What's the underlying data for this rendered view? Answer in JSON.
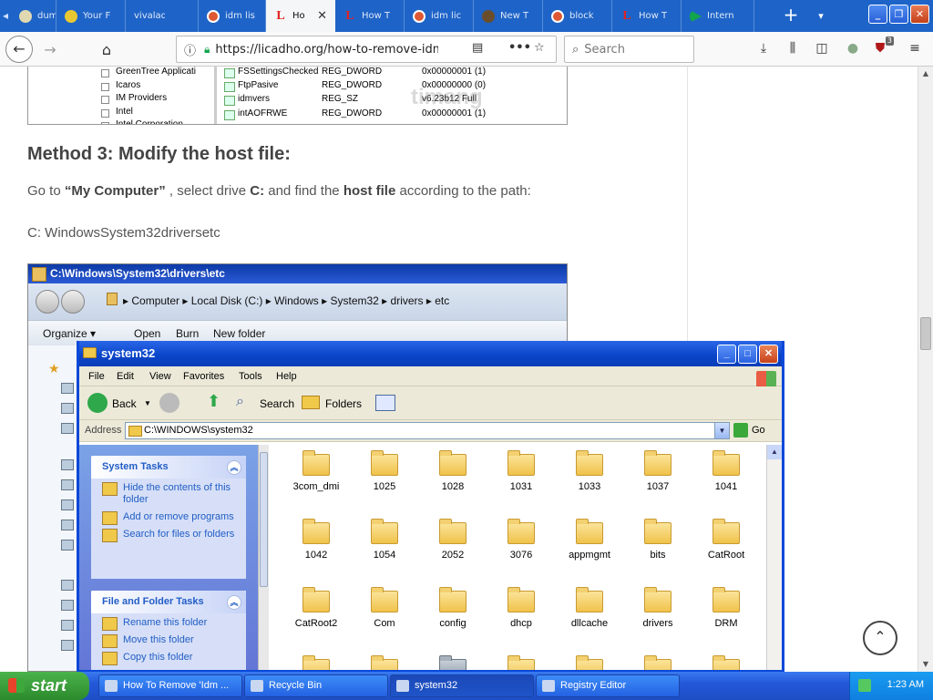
{
  "browser": {
    "tabs": [
      {
        "label": "dum",
        "favicon": "edge"
      },
      {
        "label": "Your F",
        "favicon": "yellow"
      },
      {
        "label": "vivalado",
        "favicon": "none"
      },
      {
        "label": "idm lis",
        "favicon": "duckduckgo"
      },
      {
        "label": "Ho",
        "favicon": "licadho-l",
        "active": true
      },
      {
        "label": "How T",
        "favicon": "licadho-l"
      },
      {
        "label": "idm lic",
        "favicon": "duckduckgo"
      },
      {
        "label": "New T",
        "favicon": "bug"
      },
      {
        "label": "block",
        "favicon": "duckduckgo"
      },
      {
        "label": "How T",
        "favicon": "licadho-l"
      },
      {
        "label": "Intern",
        "favicon": "play"
      }
    ],
    "url": "https://licadho.org/how-to-remove-idm-f",
    "search_placeholder": "Search",
    "addon_badge": "3",
    "colors": {
      "tabbar": "#1e64c8"
    }
  },
  "article": {
    "registry": {
      "tree": [
        "GreenTree Applicati",
        "Icaros",
        "IM Providers",
        "Intel",
        "Intel Corporation"
      ],
      "values": [
        {
          "name": "FSSettingsChecked",
          "type": "REG_DWORD",
          "data": "0x00000001 (1)"
        },
        {
          "name": "FtpPasive",
          "type": "REG_DWORD",
          "data": "0x00000000 (0)"
        },
        {
          "name": "idmvers",
          "type": "REG_SZ",
          "data": "v6.23b12 Full"
        },
        {
          "name": "intAOFRWE",
          "type": "REG_DWORD",
          "data": "0x00000001 (1)"
        }
      ],
      "watermark": "timang"
    },
    "heading": "Method 3: Modify the host file:",
    "para1_pre": "Go to ",
    "para1_b1": "“My Computer”",
    "para1_mid1": " , select drive ",
    "para1_b2": "C:",
    "para1_mid2": " and find the ",
    "para1_b3": "host file",
    "para1_post": " according to the path:",
    "path": "C: WindowsSystem32driversetc",
    "w7shot": {
      "title": "C:\\Windows\\System32\\drivers\\etc",
      "breadcrumb": "▸  Computer  ▸  Local Disk (C:)  ▸  Windows  ▸  System32  ▸  drivers  ▸  etc",
      "toolbar": [
        "Organize ▾",
        "Open",
        "Burn",
        "New folder"
      ]
    }
  },
  "xp_window": {
    "title": "system32",
    "menu": [
      "File",
      "Edit",
      "View",
      "Favorites",
      "Tools",
      "Help"
    ],
    "toolbar": {
      "back": "Back",
      "search": "Search",
      "folders": "Folders"
    },
    "address_label": "Address",
    "address": "C:\\WINDOWS\\system32",
    "go": "Go",
    "system_tasks": {
      "title": "System Tasks",
      "items": [
        "Hide the contents of this folder",
        "Add or remove programs",
        "Search for files or folders"
      ]
    },
    "file_tasks": {
      "title": "File and Folder Tasks",
      "items": [
        "Rename this folder",
        "Move this folder",
        "Copy this folder"
      ]
    },
    "folders": [
      "3com_dmi",
      "1025",
      "1028",
      "1031",
      "1033",
      "1037",
      "1041",
      "1042",
      "1054",
      "2052",
      "3076",
      "appmgmt",
      "bits",
      "CatRoot",
      "CatRoot2",
      "Com",
      "config",
      "dhcp",
      "dllcache",
      "drivers",
      "DRM"
    ]
  },
  "taskbar": {
    "start": "start",
    "tasks": [
      "How To Remove 'Idm ...",
      "Recycle Bin",
      "system32",
      "Registry Editor"
    ],
    "clock": "1:23 AM"
  }
}
